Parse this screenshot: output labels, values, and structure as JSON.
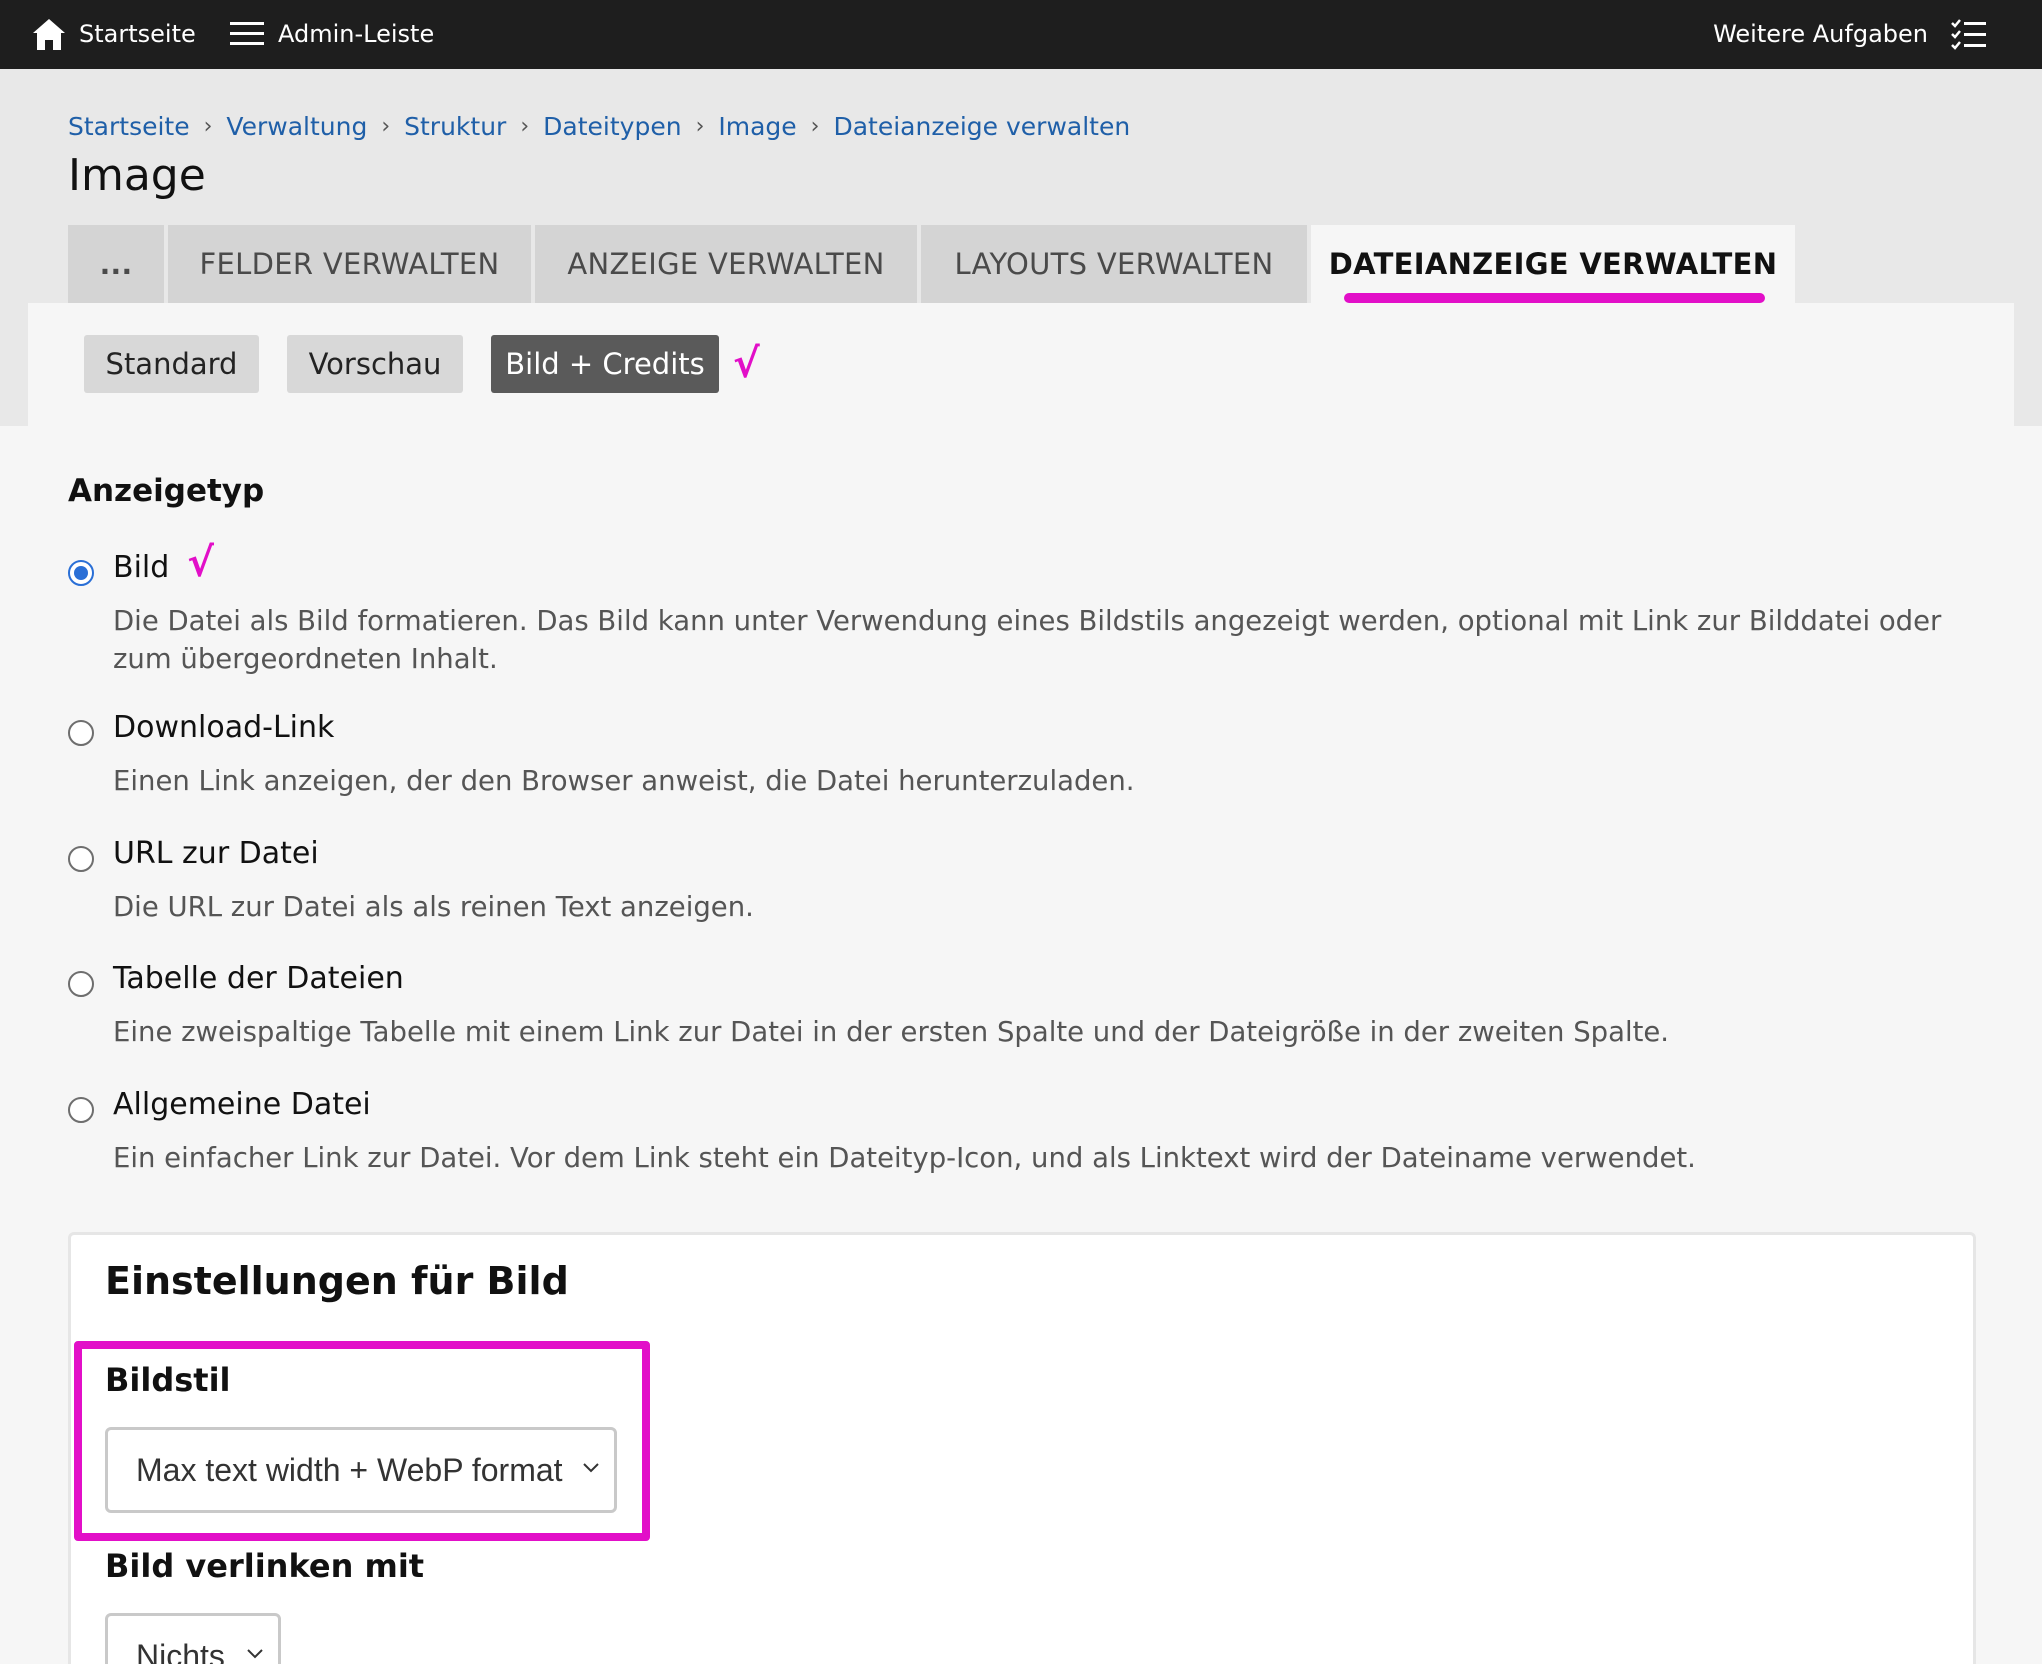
{
  "toolbar": {
    "home_label": "Startseite",
    "admin_label": "Admin-Leiste",
    "more_label": "Weitere Aufgaben"
  },
  "breadcrumb": [
    "Startseite",
    "Verwaltung",
    "Struktur",
    "Dateitypen",
    "Image",
    "Dateianzeige verwalten"
  ],
  "page": {
    "title": "Image"
  },
  "tabs": {
    "dots": "...",
    "items": [
      "FELDER VERWALTEN",
      "ANZEIGE VERWALTEN",
      "LAYOUTS VERWALTEN",
      "DATEIANZEIGE VERWALTEN"
    ],
    "active_index": 3
  },
  "subtabs": {
    "items": [
      "Standard",
      "Vorschau",
      "Bild + Credits"
    ],
    "active_index": 2
  },
  "annotation": {
    "checkmark": "√",
    "color": "#e20fc8"
  },
  "display_type": {
    "title": "Anzeigetyp",
    "options": [
      {
        "label": "Bild",
        "desc": "Die Datei als Bild formatieren. Das Bild kann unter Verwendung eines Bildstils angezeigt werden, optional mit Link zur Bilddatei oder zum übergeordneten Inhalt.",
        "checked": true
      },
      {
        "label": "Download-Link",
        "desc": "Einen Link anzeigen, der den Browser anweist, die Datei herunterzuladen.",
        "checked": false
      },
      {
        "label": "URL zur Datei",
        "desc": "Die URL zur Datei als als reinen Text anzeigen.",
        "checked": false
      },
      {
        "label": "Tabelle der Dateien",
        "desc": "Eine zweispaltige Tabelle mit einem Link zur Datei in der ersten Spalte und der Dateigröße in der zweiten Spalte.",
        "checked": false
      },
      {
        "label": "Allgemeine Datei",
        "desc": "Ein einfacher Link zur Datei. Vor dem Link steht ein Dateityp-Icon, und als Linktext wird der Dateiname verwendet.",
        "checked": false
      }
    ]
  },
  "settings": {
    "title": "Einstellungen für Bild",
    "image_style": {
      "label": "Bildstil",
      "value": "Max text width + WebP format"
    },
    "link_to": {
      "label": "Bild verlinken mit",
      "value": "Nichts"
    }
  },
  "colors": {
    "accent": "#e20fc8",
    "link": "#1f5fa8",
    "radio_checked": "#2a6fd6"
  }
}
